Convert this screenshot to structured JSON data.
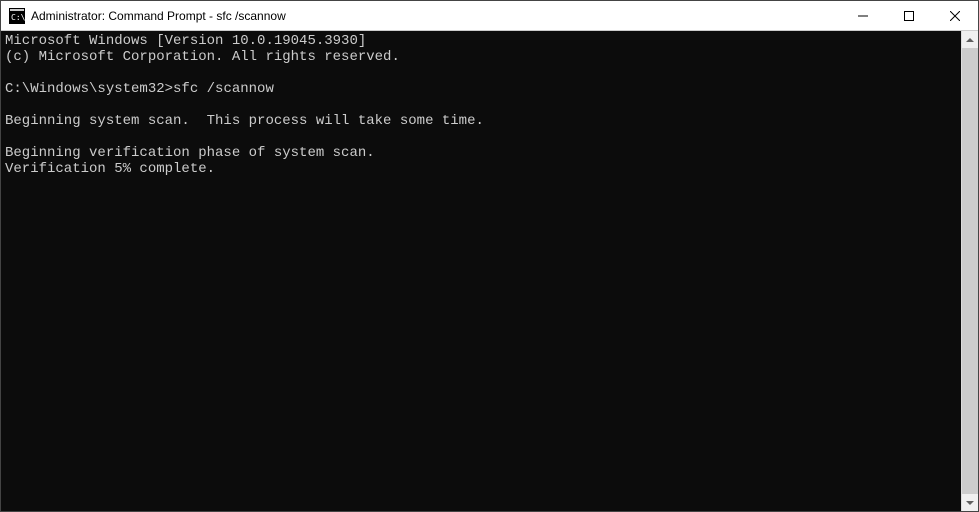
{
  "titlebar": {
    "title": "Administrator: Command Prompt - sfc  /scannow",
    "icon_name": "cmd-icon",
    "minimize_label": "Minimize",
    "maximize_label": "Maximize",
    "close_label": "Close"
  },
  "terminal": {
    "line1": "Microsoft Windows [Version 10.0.19045.3930]",
    "line2": "(c) Microsoft Corporation. All rights reserved.",
    "blank1": "",
    "prompt_path": "C:\\Windows\\system32>",
    "command": "sfc /scannow",
    "blank2": "",
    "line3": "Beginning system scan.  This process will take some time.",
    "blank3": "",
    "line4": "Beginning verification phase of system scan.",
    "line5": "Verification 5% complete."
  }
}
